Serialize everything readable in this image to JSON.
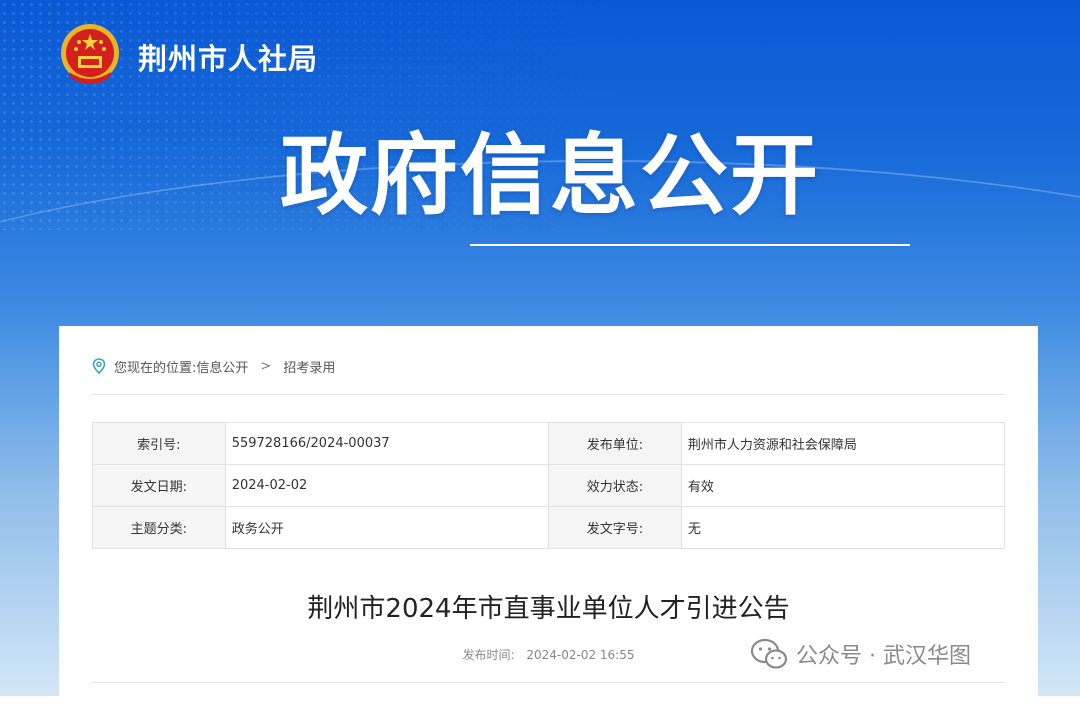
{
  "header": {
    "site_name": "荆州市人社局",
    "banner_title": "政府信息公开"
  },
  "breadcrumb": {
    "prefix": "您现在的位置:",
    "items": [
      "信息公开",
      "招考录用"
    ],
    "separator": ">"
  },
  "meta": {
    "rows": [
      {
        "k1": "索引号:",
        "v1": "559728166/2024-00037",
        "k2": "发布单位:",
        "v2": "荆州市人力资源和社会保障局"
      },
      {
        "k1": "发文日期:",
        "v1": "2024-02-02",
        "k2": "效力状态:",
        "v2": "有效"
      },
      {
        "k1": "主题分类:",
        "v1": "政务公开",
        "k2": "发文字号:",
        "v2": "无"
      }
    ]
  },
  "article": {
    "title": "荆州市2024年市直事业单位人才引进公告",
    "publish_label": "发布时间:",
    "publish_time": "2024-02-02 16:55"
  },
  "watermark": {
    "text": "公众号 · 武汉华图"
  },
  "icons": {
    "logo": "national-emblem-icon",
    "pin": "location-pin-icon",
    "wechat": "wechat-icon"
  },
  "colors": {
    "brand_blue": "#0a58d4",
    "pin_teal": "#3aa6b9"
  }
}
